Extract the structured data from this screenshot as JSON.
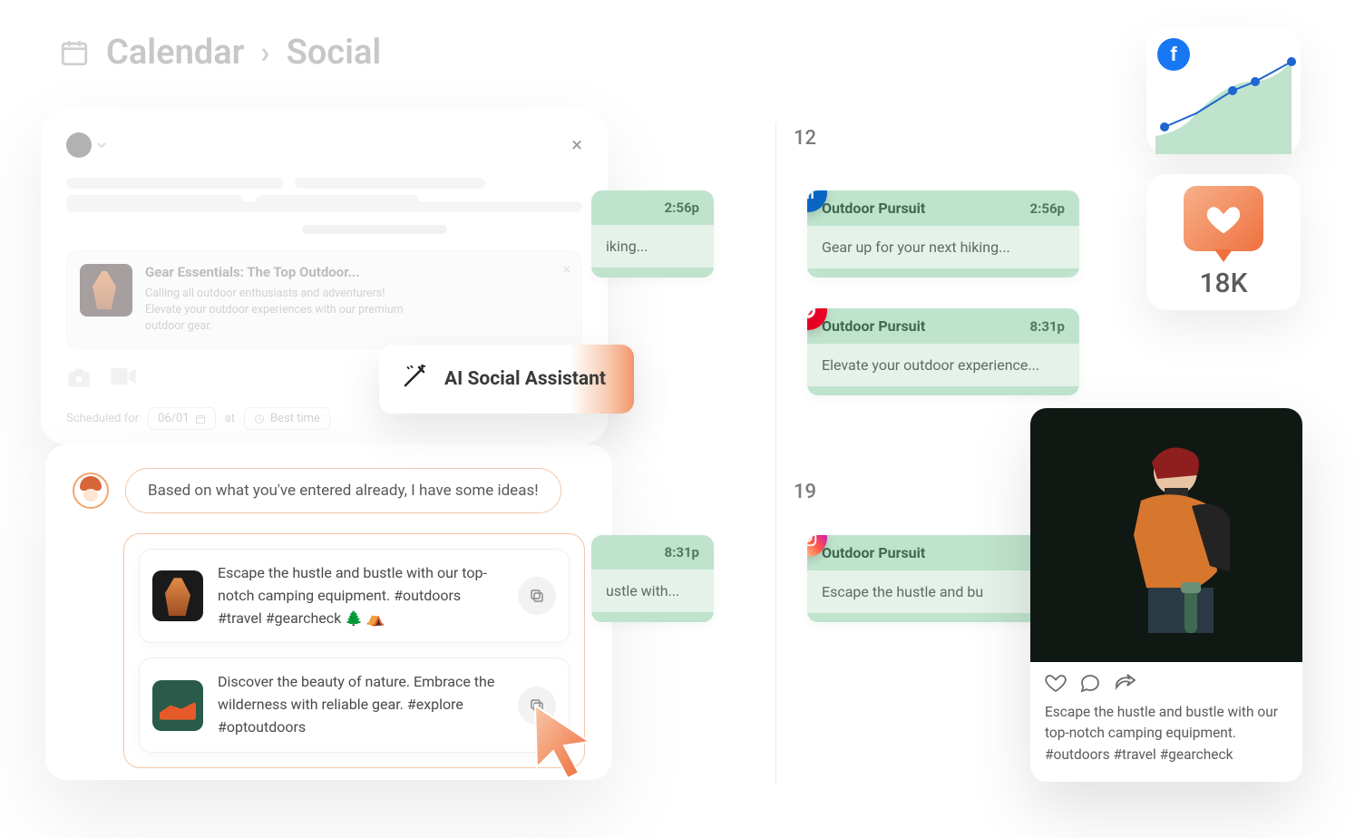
{
  "breadcrumb": {
    "calendar": "Calendar",
    "social": "Social"
  },
  "compose": {
    "attach_title": "Gear Essentials: The Top Outdoor...",
    "attach_desc": "Calling all outdoor enthusiasts and adventurers! Elevate your outdoor experiences with our premium outdoor gear.",
    "scheduled_label": "Scheduled for",
    "scheduled_date": "06/01",
    "scheduled_at": "at",
    "scheduled_time": "Best time"
  },
  "ai_pill": {
    "label": "AI Social Assistant"
  },
  "assistant": {
    "intro": "Based on what you've entered already, I have some ideas!",
    "ideas": [
      {
        "text": "Escape the hustle and bustle with our top-notch camping equipment. #outdoors #travel #gearcheck 🌲 ⛺"
      },
      {
        "text": "Discover the beauty of nature. Embrace the wilderness with reliable gear. #explore #optoutdoors"
      }
    ]
  },
  "calendar": {
    "day_a": "12",
    "day_b": "19",
    "left_a_time": "2:56p",
    "left_a_body": "iking...",
    "left_b_time": "8:31p",
    "left_b_body": "ustle with...",
    "ev1": {
      "title": "Outdoor Pursuit",
      "time": "2:56p",
      "body": "Gear up for your next hiking..."
    },
    "ev2": {
      "title": "Outdoor Pursuit",
      "time": "8:31p",
      "body": "Elevate your outdoor experience..."
    },
    "ev3": {
      "title": "Outdoor Pursuit",
      "time": "",
      "body": "Escape the hustle and bu"
    }
  },
  "stats": {
    "likes": "18K"
  },
  "ig_preview": {
    "caption": "Escape the hustle and bustle with our top-notch camping equipment. #outdoors #travel #gearcheck"
  }
}
